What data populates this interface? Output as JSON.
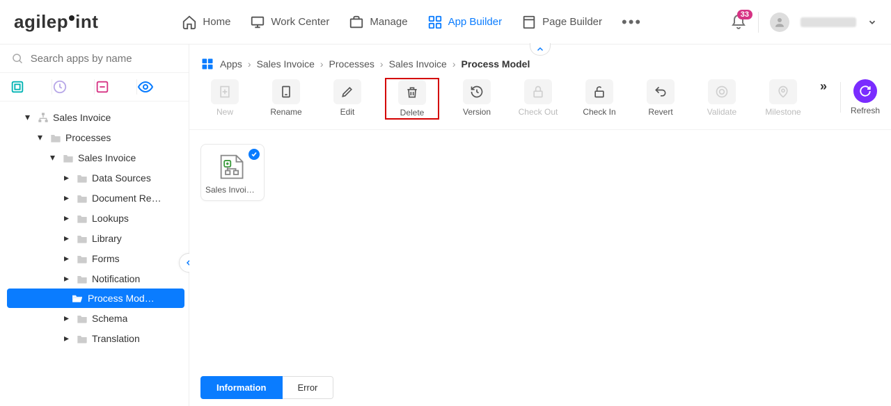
{
  "brand": "agilepoint",
  "notification_count": "33",
  "nav": [
    {
      "label": "Home",
      "active": false
    },
    {
      "label": "Work Center",
      "active": false
    },
    {
      "label": "Manage",
      "active": false
    },
    {
      "label": "App Builder",
      "active": true
    },
    {
      "label": "Page Builder",
      "active": false
    }
  ],
  "search": {
    "placeholder": "Search apps by name"
  },
  "tree": {
    "root": {
      "label": "Sales Invoice"
    },
    "processes": {
      "label": "Processes"
    },
    "salesInvoice": {
      "label": "Sales Invoice"
    },
    "children": [
      {
        "label": "Data Sources"
      },
      {
        "label": "Document Re…"
      },
      {
        "label": "Lookups"
      },
      {
        "label": "Library"
      },
      {
        "label": "Forms"
      },
      {
        "label": "Notification"
      },
      {
        "label": "Process Mod…",
        "selected": true
      },
      {
        "label": "Schema"
      },
      {
        "label": "Translation"
      }
    ]
  },
  "breadcrumb": [
    "Apps",
    "Sales Invoice",
    "Processes",
    "Sales Invoice",
    "Process Model"
  ],
  "toolbar": [
    {
      "key": "new",
      "label": "New",
      "disabled": true
    },
    {
      "key": "rename",
      "label": "Rename",
      "disabled": false
    },
    {
      "key": "edit",
      "label": "Edit",
      "disabled": false
    },
    {
      "key": "delete",
      "label": "Delete",
      "disabled": false,
      "highlight": true
    },
    {
      "key": "version",
      "label": "Version",
      "disabled": false
    },
    {
      "key": "checkout",
      "label": "Check Out",
      "disabled": true
    },
    {
      "key": "checkin",
      "label": "Check In",
      "disabled": false
    },
    {
      "key": "revert",
      "label": "Revert",
      "disabled": false
    },
    {
      "key": "validate",
      "label": "Validate",
      "disabled": true
    },
    {
      "key": "milestone",
      "label": "Milestone",
      "disabled": true
    }
  ],
  "refresh": {
    "label": "Refresh"
  },
  "card": {
    "label": "Sales Invoi…"
  },
  "tabs": {
    "info": "Information",
    "error": "Error"
  }
}
